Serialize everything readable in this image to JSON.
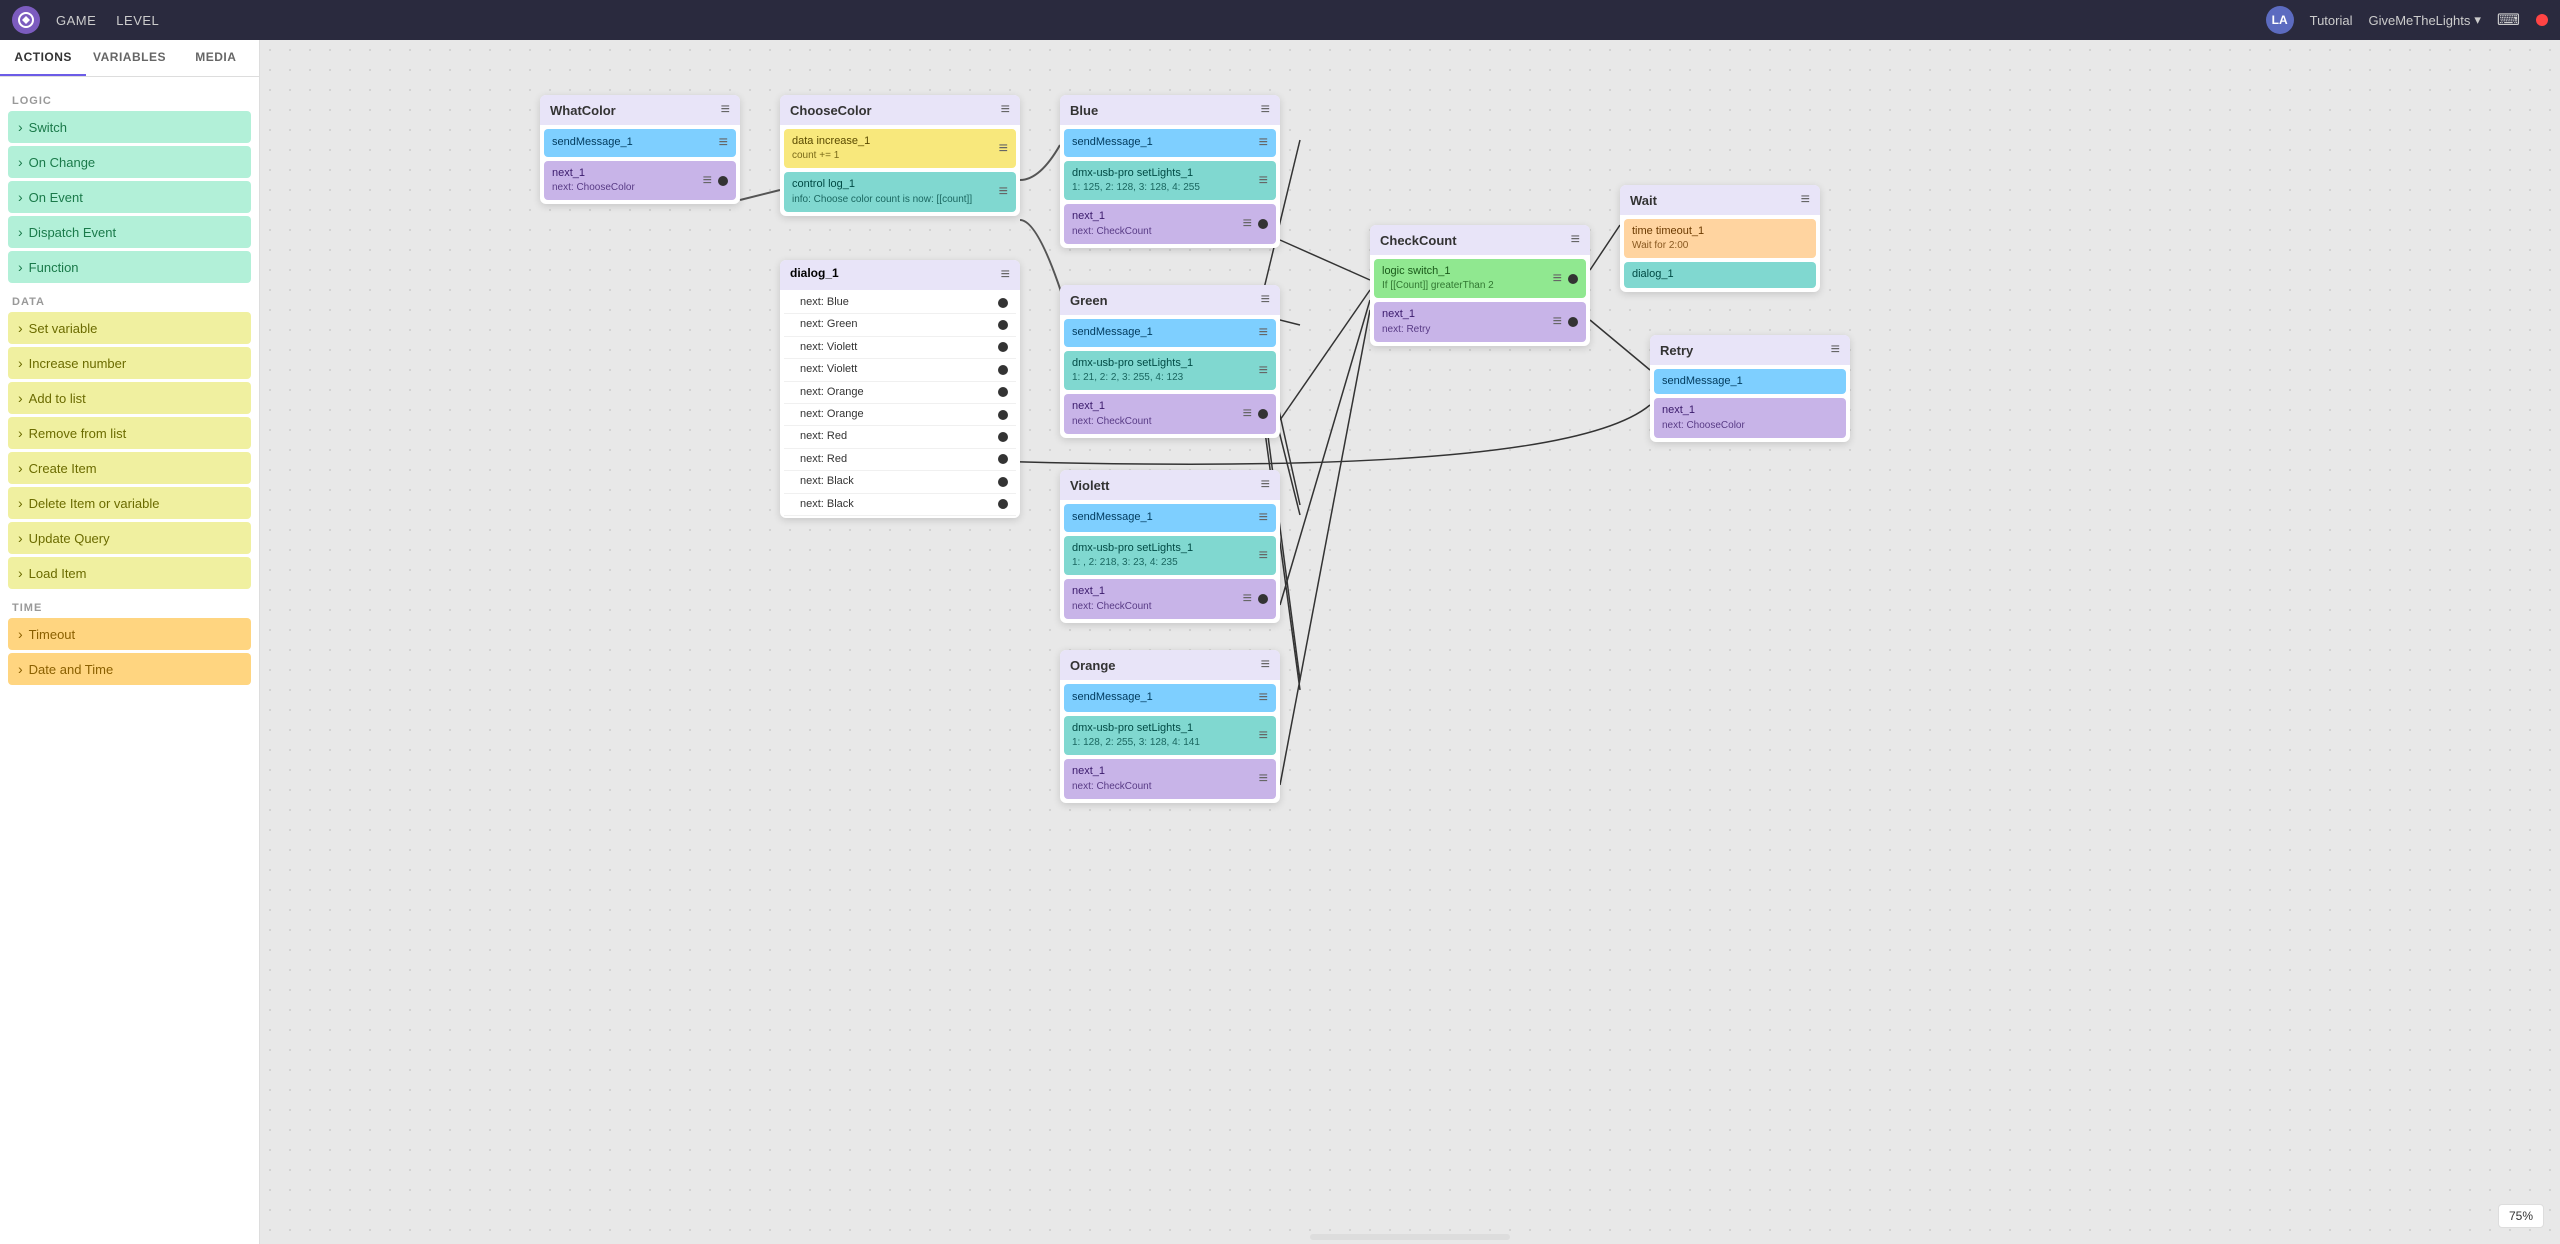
{
  "topbar": {
    "logo": "LA",
    "nav": [
      "GAME",
      "LEVEL"
    ],
    "project": "Tutorial",
    "dropdown": "GiveMeTheLights",
    "terminal_icon": "⌨",
    "status_color": "#ff4444"
  },
  "sidebar": {
    "tabs": [
      "ACTIONS",
      "VARIABLES",
      "MEDIA"
    ],
    "active_tab": "ACTIONS",
    "sections": [
      {
        "label": "LOGIC",
        "items": [
          {
            "id": "switch",
            "label": "Switch",
            "type": "logic"
          },
          {
            "id": "on-change",
            "label": "On Change",
            "type": "logic"
          },
          {
            "id": "on-event",
            "label": "On Event",
            "type": "logic"
          },
          {
            "id": "dispatch-event",
            "label": "Dispatch Event",
            "type": "logic"
          },
          {
            "id": "function",
            "label": "Function",
            "type": "logic"
          }
        ]
      },
      {
        "label": "DATA",
        "items": [
          {
            "id": "set-variable",
            "label": "Set variable",
            "type": "data"
          },
          {
            "id": "increase-number",
            "label": "Increase number",
            "type": "data"
          },
          {
            "id": "add-to-list",
            "label": "Add to list",
            "type": "data"
          },
          {
            "id": "remove-from-list",
            "label": "Remove from list",
            "type": "data"
          },
          {
            "id": "create-item",
            "label": "Create Item",
            "type": "data"
          },
          {
            "id": "delete-item",
            "label": "Delete Item or variable",
            "type": "data"
          },
          {
            "id": "update-query",
            "label": "Update Query",
            "type": "data"
          },
          {
            "id": "load-item",
            "label": "Load Item",
            "type": "data"
          }
        ]
      },
      {
        "label": "TIME",
        "items": [
          {
            "id": "timeout",
            "label": "Timeout",
            "type": "time"
          },
          {
            "id": "date-time",
            "label": "Date and Time",
            "type": "time"
          }
        ]
      }
    ]
  },
  "nodes": {
    "whatcolor": {
      "title": "WhatColor",
      "blocks": [
        {
          "id": "sendMessage_1",
          "label": "sendMessage_1",
          "type": "blue",
          "port": true
        },
        {
          "id": "next_1",
          "label": "next_1",
          "type": "purple",
          "subtext": "next: ChooseColor",
          "port": false
        }
      ]
    },
    "choosecolor": {
      "title": "ChooseColor",
      "blocks": [
        {
          "id": "data_increase_1",
          "label": "data increase_1",
          "sublabel": "count += 1",
          "type": "yellow",
          "port": true
        },
        {
          "id": "control_log_1",
          "label": "control log_1",
          "sublabel": "info: Choose color count is now: [[count]]",
          "type": "teal",
          "port": false
        }
      ]
    },
    "blue": {
      "title": "Blue",
      "blocks": [
        {
          "id": "sendMessage_1",
          "label": "sendMessage_1",
          "type": "blue",
          "port": true
        },
        {
          "id": "dmx_1",
          "label": "dmx-usb-pro setLights_1",
          "sublabel": "1: 125, 2: 128, 3: 128, 4: 255",
          "type": "teal",
          "port": true
        },
        {
          "id": "next_1",
          "label": "next_1",
          "subtext": "next: CheckCount",
          "type": "purple",
          "port": true
        }
      ]
    },
    "green": {
      "title": "Green",
      "blocks": [
        {
          "id": "sendMessage_1",
          "label": "sendMessage_1",
          "type": "blue",
          "port": true
        },
        {
          "id": "dmx_1",
          "label": "dmx-usb-pro setLights_1",
          "sublabel": "1: 21, 2: 2, 3: 255, 4: 123",
          "type": "teal",
          "port": true
        },
        {
          "id": "next_1",
          "label": "next_1",
          "subtext": "next: CheckCount",
          "type": "purple",
          "port": true
        }
      ]
    },
    "violett": {
      "title": "Violett",
      "blocks": [
        {
          "id": "sendMessage_1",
          "label": "sendMessage_1",
          "type": "blue",
          "port": true
        },
        {
          "id": "dmx_1",
          "label": "dmx-usb-pro setLights_1",
          "sublabel": "1: , 2: 218, 3: 23, 4: 235",
          "type": "teal",
          "port": true
        },
        {
          "id": "next_1",
          "label": "next_1",
          "subtext": "next: CheckCount",
          "type": "purple",
          "port": true
        }
      ]
    },
    "orange": {
      "title": "Orange",
      "blocks": [
        {
          "id": "sendMessage_1",
          "label": "sendMessage_1",
          "type": "blue",
          "port": true
        },
        {
          "id": "dmx_1",
          "label": "dmx-usb-pro setLights_1",
          "sublabel": "1: 128, 2: 255, 3: 128, 4: 141",
          "type": "teal",
          "port": true
        },
        {
          "id": "next_1",
          "label": "next_1",
          "subtext": "next: CheckCount",
          "type": "purple",
          "port": false
        }
      ]
    },
    "checkcount": {
      "title": "CheckCount",
      "blocks": [
        {
          "id": "logic_switch_1",
          "label": "logic switch_1",
          "sublabel": "If [[Count]] greaterThan 2",
          "type": "green",
          "port": true
        },
        {
          "id": "next_1",
          "label": "next_1",
          "subtext": "next: Retry",
          "type": "purple",
          "port": true
        }
      ]
    },
    "wait": {
      "title": "Wait",
      "blocks": [
        {
          "id": "time_timeout_1",
          "label": "time timeout_1",
          "sublabel": "Wait for 2:00",
          "type": "orange-light",
          "port": false
        },
        {
          "id": "dialog_1",
          "label": "dialog_1",
          "type": "teal",
          "port": false
        }
      ]
    },
    "retry": {
      "title": "Retry",
      "blocks": [
        {
          "id": "sendMessage_1",
          "label": "sendMessage_1",
          "type": "blue",
          "port": false
        },
        {
          "id": "next_1",
          "label": "next_1",
          "subtext": "next: ChooseColor",
          "type": "purple",
          "port": false
        }
      ]
    }
  },
  "dialog_node": {
    "title": "dialog_1",
    "rows": [
      "next: Blue",
      "next: Green",
      "next: Violett",
      "next: Violett",
      "next: Orange",
      "next: Orange",
      "next: Red",
      "next: Red",
      "next: Black",
      "next: Black"
    ]
  },
  "zoom": "75%"
}
